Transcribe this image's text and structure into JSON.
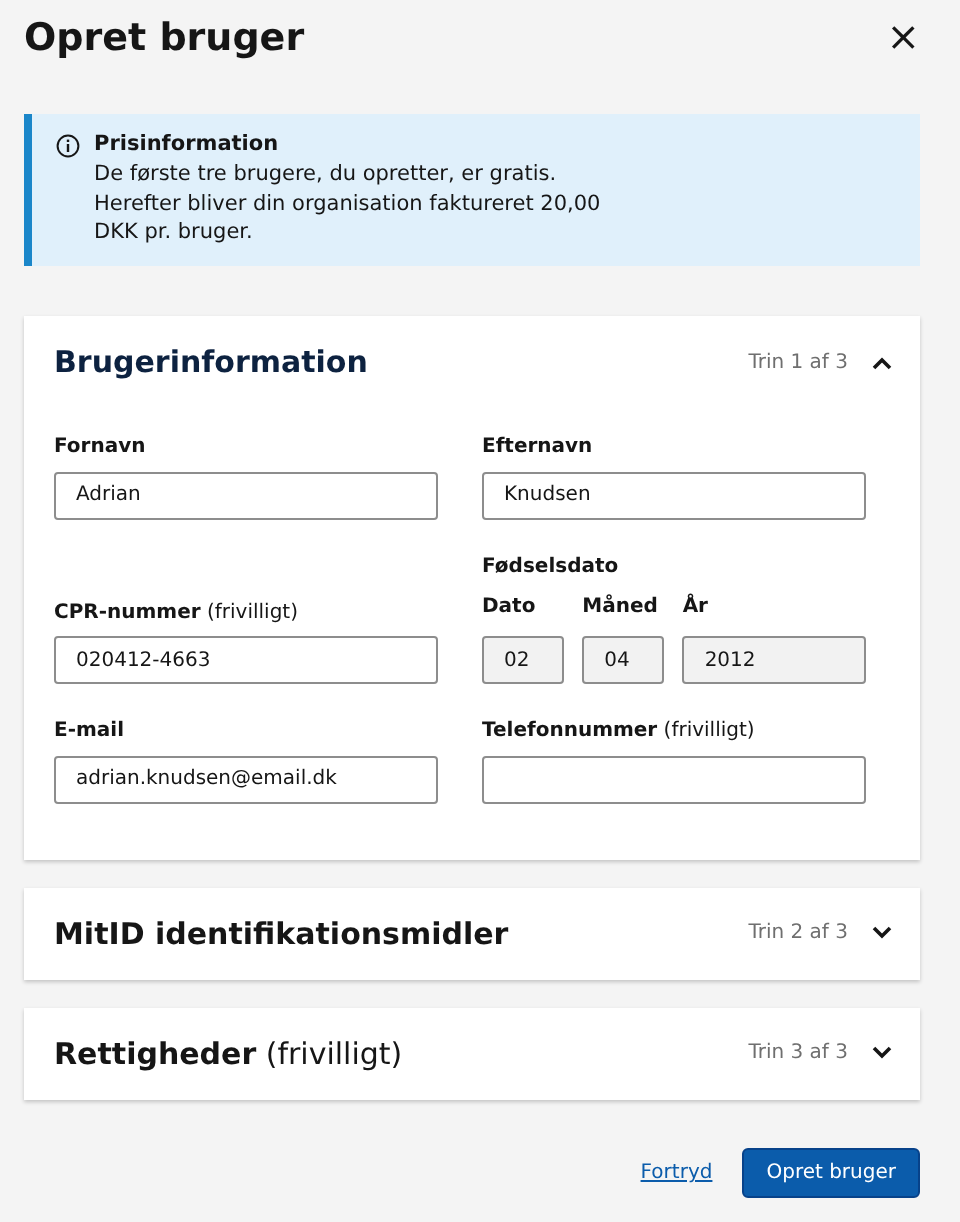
{
  "dialog": {
    "title": "Opret bruger",
    "close": "×"
  },
  "notice": {
    "title": "Prisinformation",
    "text": "De første tre brugere, du opretter, er gratis. Herefter bliver din organisation faktureret 20,00 DKK pr. bruger."
  },
  "sections": [
    {
      "title": "Brugerinformation",
      "step": "Trin 1 af 3",
      "expanded": true,
      "rows": [
        {
          "fields": [
            {
              "kind": "text",
              "label": "Fornavn",
              "value": "Adrian",
              "disabled": false
            },
            {
              "kind": "text",
              "label": "Efternavn",
              "value": "Knudsen",
              "disabled": false
            }
          ]
        },
        {
          "fields": [
            {
              "kind": "text",
              "label": "**CPR-nummer** (frivilligt)",
              "value": "020412-4663",
              "disabled": false
            },
            {
              "kind": "date",
              "label": "Fødselsdato",
              "parts": [
                {
                  "label": "Dato",
                  "value": "02",
                  "disabled": true
                },
                {
                  "label": "Måned",
                  "value": "04",
                  "disabled": true
                },
                {
                  "label": "År",
                  "value": "2012",
                  "disabled": true
                }
              ]
            }
          ]
        },
        {
          "fields": [
            {
              "kind": "text",
              "label": "E-mail",
              "value": "adrian.knudsen@email.dk",
              "disabled": false
            },
            {
              "kind": "text",
              "label": "**Telefonnummer** (frivilligt)",
              "disabled": false
            }
          ]
        }
      ]
    },
    {
      "title": "MitID identifikationsmidler",
      "step": "Trin 2 af 3",
      "expanded": false
    },
    {
      "title": "**Rettigheder** (frivilligt)",
      "step": "Trin 3 af 3",
      "expanded": false
    }
  ],
  "actions": {
    "cancel": "Fortryd",
    "submit": "Opret bruger"
  }
}
